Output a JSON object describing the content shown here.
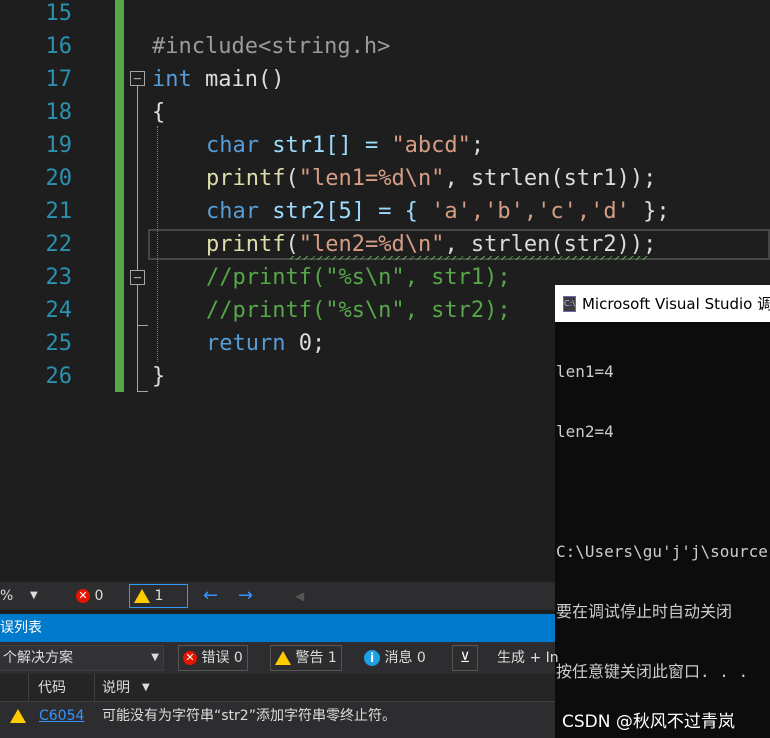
{
  "editor": {
    "lines": [
      {
        "num": "15"
      },
      {
        "num": "16",
        "text": "#include<string.h>"
      },
      {
        "num": "17",
        "kw": "int",
        "rest": " main()"
      },
      {
        "num": "18",
        "text": "{"
      },
      {
        "num": "19",
        "kw": "char",
        "rest": " str1[] = ",
        "str": "\"abcd\"",
        "tail": ";"
      },
      {
        "num": "20",
        "fn": "printf",
        "a": "(",
        "str": "\"len1=%d\\n\"",
        "rest": ", strlen(str1));"
      },
      {
        "num": "21",
        "kw": "char",
        "rest": " str2[5] = { ",
        "str": "'a','b','c','d'",
        "tail": " };"
      },
      {
        "num": "22",
        "fn": "printf",
        "a": "(",
        "str": "\"len2=%d\\n\"",
        "rest": ", strlen(str2));"
      },
      {
        "num": "23",
        "comment": "//printf(\"%s\\n\", str1);"
      },
      {
        "num": "24",
        "comment": "//printf(\"%s\\n\", str2);"
      },
      {
        "num": "25",
        "kw": "return",
        "rest": " 0;"
      },
      {
        "num": "26",
        "text": "}"
      }
    ],
    "fold_symbol": "−"
  },
  "console": {
    "title": "Microsoft Visual Studio 调",
    "icon_text": "C:\\",
    "output": [
      "len1=4",
      "len2=4",
      "",
      "C:\\Users\\gu'j'j\\source",
      "要在调试停止时自动关闭",
      "按任意键关闭此窗口. . ."
    ],
    "watermark": "CSDN @秋风不过青岚"
  },
  "statusbar": {
    "zoom": "%",
    "errors": "0",
    "warnings": "1"
  },
  "error_list": {
    "title": "误列表",
    "scope": "个解决方案",
    "errors_label": "错误 0",
    "warnings_label": "警告 1",
    "messages_label": "消息 0",
    "build_label": "生成 + In",
    "columns": {
      "code": "代码",
      "desc": "说明"
    },
    "row": {
      "code": "C6054",
      "desc": "可能没有为字符串“str2”添加字符串零终止符。"
    }
  },
  "colors": {
    "accent": "#007acc",
    "keyword": "#569cd6",
    "string": "#d69d85",
    "comment": "#57a64a",
    "line_number": "#2b91af"
  }
}
